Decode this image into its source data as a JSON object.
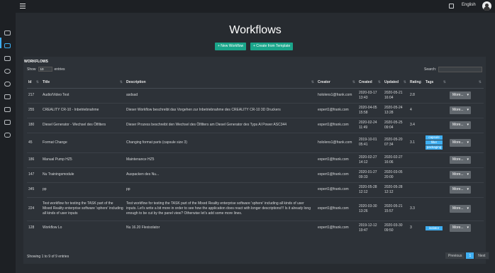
{
  "header": {
    "language": "English",
    "menu_icon": "hamburger-icon",
    "fullscreen_icon": "fullscreen-icon",
    "avatar_icon": "user-avatar-icon"
  },
  "sidebar": {
    "icons": [
      "cloud-upload-icon",
      "desktop-icon",
      "layers-icon",
      "user-icon",
      "cloud-icon",
      "devices-icon",
      "copy-icon",
      "clone-icon",
      "database-icon"
    ]
  },
  "page": {
    "title": "Workflows"
  },
  "actions": {
    "new_workflow": "+ New Workflow",
    "create_from_template": "+ Create from Template"
  },
  "panel": {
    "title": "WORKFLOWS",
    "show_label": "Show",
    "show_value": "10",
    "entries_label": "entries",
    "search_label": "Search:",
    "columns": [
      "Id",
      "Title",
      "Description",
      "Creator",
      "Created",
      "Updated",
      "Rating",
      "Tags",
      ""
    ],
    "rows": [
      {
        "id": "217",
        "title": "Audio/Video Test",
        "description": "asdsad",
        "creator": "hololens1@frank.com",
        "created": "2020-03-17\n13:43",
        "updated": "2020-05-21\n16:04",
        "rating": "2.8",
        "tags": [],
        "more": "More..."
      },
      {
        "id": "255",
        "title": "CREALITY CR-10 - Inbetriebnahme",
        "description": "Dieser Workflow beschreibt das Vorgehen zur Inbetriebnahme des CREALITY CR-10 3D Druckers",
        "creator": "expert1@frank.com",
        "created": "2020-04-05\n15:58",
        "updated": "2020-05-24\n13:28",
        "rating": "4",
        "tags": [],
        "more": "More..."
      },
      {
        "id": "180",
        "title": "Diesel Generator - Wechsel des Ölfilters",
        "description": "Dieser Prozess beschreibt den Wechsel des Ölfilters am Diesel Generator des Typs Al Power ASC344",
        "creator": "expert1@frank.com",
        "created": "2020-02-24\n11:49",
        "updated": "2020-05-25\n09:04",
        "rating": "3.4",
        "tags": [],
        "more": "More..."
      },
      {
        "id": "45",
        "title": "Format Change",
        "description": "Changing format parts (capsule size 3)",
        "creator": "hololens1@frank.com",
        "created": "2019-10-01\n05:41",
        "updated": "2020-05-20\n07:34",
        "rating": "3.1",
        "tags": [
          "capsule",
          "filler",
          "packaging"
        ],
        "more": "More..."
      },
      {
        "id": "186",
        "title": "Manual Pump HZ5",
        "description": "Maintenance HZ5",
        "creator": "expert1@frank.com",
        "created": "2020-02-27\n14:12",
        "updated": "2020-02-27\n16:06",
        "rating": "",
        "tags": [],
        "more": "More..."
      },
      {
        "id": "147",
        "title": "Nu Trainingsmodule",
        "description": "Auspacken des Nu...",
        "creator": "expert1@frank.com",
        "created": "2020-01-27\n09:33",
        "updated": "2020-03-05\n20:00",
        "rating": "",
        "tags": [],
        "more": "More..."
      },
      {
        "id": "345",
        "title": "pp",
        "description": "pp",
        "creator": "expert1@frank.com",
        "created": "2020-05-28\n12:12",
        "updated": "2020-05-28\n12:12",
        "rating": "",
        "tags": [],
        "more": "More..."
      },
      {
        "id": "224",
        "title": "Test workflow for testing the TASK part of the Mixed Reality enterprise software 'sphere' including all kinds of user inputs",
        "description": "Test workflow for testing the TASK part of the Mixed Reality enterprise software 'sphere' including all kinds of user inputs. Let's write a bit more in order to see how the application does react with longer descriptions!!! Is it already long enough to be cut by the panel view? Otherwise let's add some more lines.",
        "creator": "expert1@frank.com",
        "created": "2020-03-30\n13:26",
        "updated": "2020-05-21\n15:57",
        "rating": "3.3",
        "tags": [],
        "more": "More..."
      },
      {
        "id": "128",
        "title": "Workflow Lo",
        "description": "Nu 16.20 Flexisolator",
        "creator": "expert1@frank.com",
        "created": "2019-12-12\n19:47",
        "updated": "2020-03-30\n09:50",
        "rating": "3",
        "tags": [
          "isolator"
        ],
        "more": "More..."
      }
    ],
    "info": "Showing 1 to 9 of 9 entries",
    "pager": {
      "previous": "Previous",
      "current": "1",
      "next": "Next"
    }
  }
}
